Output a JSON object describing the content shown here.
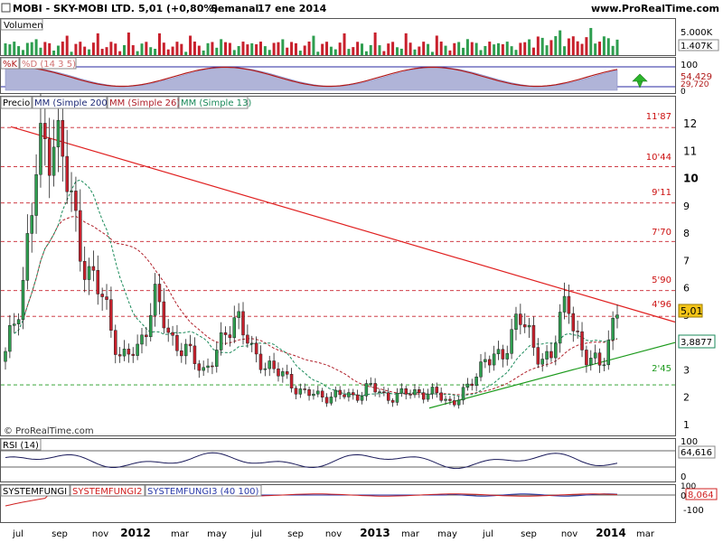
{
  "header": {
    "symbol": "MOBI - SKY-MOBI LTD.",
    "price": "5,01 (+0,80%)",
    "period": "Semanal",
    "date": "17 ene 2014",
    "site": "www.ProRealTime.com"
  },
  "watermark": "© ProRealTime.com",
  "colors": {
    "up": "#2e9e4f",
    "down": "#c8202c",
    "ma200": "#1e2a78",
    "ma26": "#b0202a",
    "ma13": "#1a8a5a",
    "trend_red": "#e02020",
    "trend_green": "#1c9a1c",
    "k_line": "#b01818",
    "d_fill": "#b0b4d8",
    "sys1": "#111111",
    "sys2": "#d02020",
    "sys3": "#2a3aa8"
  },
  "volume_panel": {
    "label": "Volumen",
    "axis_labels": [
      "5.000K",
      "1.407K"
    ]
  },
  "stoch_panel": {
    "labels": [
      "%K",
      "%D (14 3 5)"
    ],
    "axis_labels": [
      "100",
      "54,429",
      "29,720",
      "0"
    ],
    "arrow": "up-arrow-icon"
  },
  "price_panel": {
    "labels": [
      "Precio",
      "MM (Simple 200)",
      "MM (Simple 26)",
      "MM (Simple 13)"
    ],
    "level_labels": [
      "11'87",
      "10'44",
      "9'11",
      "7'70",
      "5'90",
      "4'96",
      "2'45"
    ],
    "current_price": "5,01",
    "ma_value": "3,8877",
    "y_ticks": [
      "12",
      "11",
      "10",
      "9",
      "8",
      "7",
      "6",
      "5",
      "4",
      "3",
      "2",
      "1"
    ]
  },
  "rsi_panel": {
    "label": "RSI (14)",
    "value": "64,616",
    "axis_labels": [
      "100",
      "0"
    ]
  },
  "sys_panel": {
    "labels": [
      "SYSTEMFUNGI",
      "SYSTEMFUNGI2",
      "SYSTEMFUNGI3 (40 100)"
    ],
    "axis_labels": [
      "100",
      "0",
      "-100"
    ],
    "value": "8,064"
  },
  "x_axis": {
    "labels": [
      "jul",
      "sep",
      "nov",
      "2012",
      "mar",
      "may",
      "jul",
      "sep",
      "nov",
      "2013",
      "mar",
      "may",
      "jul",
      "sep",
      "nov",
      "2014",
      "mar"
    ]
  },
  "chart_data": {
    "type": "candlestick",
    "period": "weekly",
    "x_range": [
      "jul 2011",
      "mar 2014"
    ],
    "y_range": [
      1,
      12.5
    ],
    "price_path": [
      [
        "jul 2011",
        3.5
      ],
      [
        "jul 2011",
        6.0
      ],
      [
        "jul 2011",
        10.8
      ],
      [
        "jul 2011",
        11.9
      ],
      [
        "ago 2011",
        9.0
      ],
      [
        "ago 2011",
        6.5
      ],
      [
        "sep 2011",
        5.5
      ],
      [
        "sep 2011",
        3.3
      ],
      [
        "oct 2011",
        3.8
      ],
      [
        "nov 2011",
        5.6
      ],
      [
        "nov 2011",
        4.2
      ],
      [
        "dic 2011",
        3.6
      ],
      [
        "ene 2012",
        3.0
      ],
      [
        "feb 2012",
        3.8
      ],
      [
        "mar 2012",
        5.2
      ],
      [
        "mar 2012",
        3.4
      ],
      [
        "abr 2012",
        3.2
      ],
      [
        "may 2012",
        2.6
      ],
      [
        "may 2012",
        2.2
      ],
      [
        "jun 2012",
        2.0
      ],
      [
        "jul 2012",
        2.1
      ],
      [
        "sep 2012",
        2.0
      ],
      [
        "oct 2012",
        2.4
      ],
      [
        "nov 2012",
        2.0
      ],
      [
        "dic 2012",
        2.1
      ],
      [
        "ene 2013",
        2.2
      ],
      [
        "mar 2013",
        2.1
      ],
      [
        "abr 2013",
        1.8
      ],
      [
        "may 2013",
        2.3
      ],
      [
        "may 2013",
        3.5
      ],
      [
        "jun 2013",
        3.3
      ],
      [
        "jul 2013",
        5.2
      ],
      [
        "ago 2013",
        3.6
      ],
      [
        "sep 2013",
        3.5
      ],
      [
        "oct 2013",
        5.7
      ],
      [
        "nov 2013",
        3.3
      ],
      [
        "dic 2013",
        3.3
      ],
      [
        "ene 2014",
        5.01
      ]
    ],
    "horizontal_levels": [
      11.87,
      10.44,
      9.11,
      7.7,
      5.9,
      4.96,
      2.45
    ],
    "resistance_line": {
      "from": [
        "jul 2011",
        11.9
      ],
      "to": [
        "mar 2014",
        4.8
      ]
    },
    "support_line": {
      "from": [
        "abr 2013",
        1.6
      ],
      "to": [
        "mar 2014",
        3.8
      ]
    },
    "last_close": 5.01,
    "ma13_last": 3.8877
  }
}
